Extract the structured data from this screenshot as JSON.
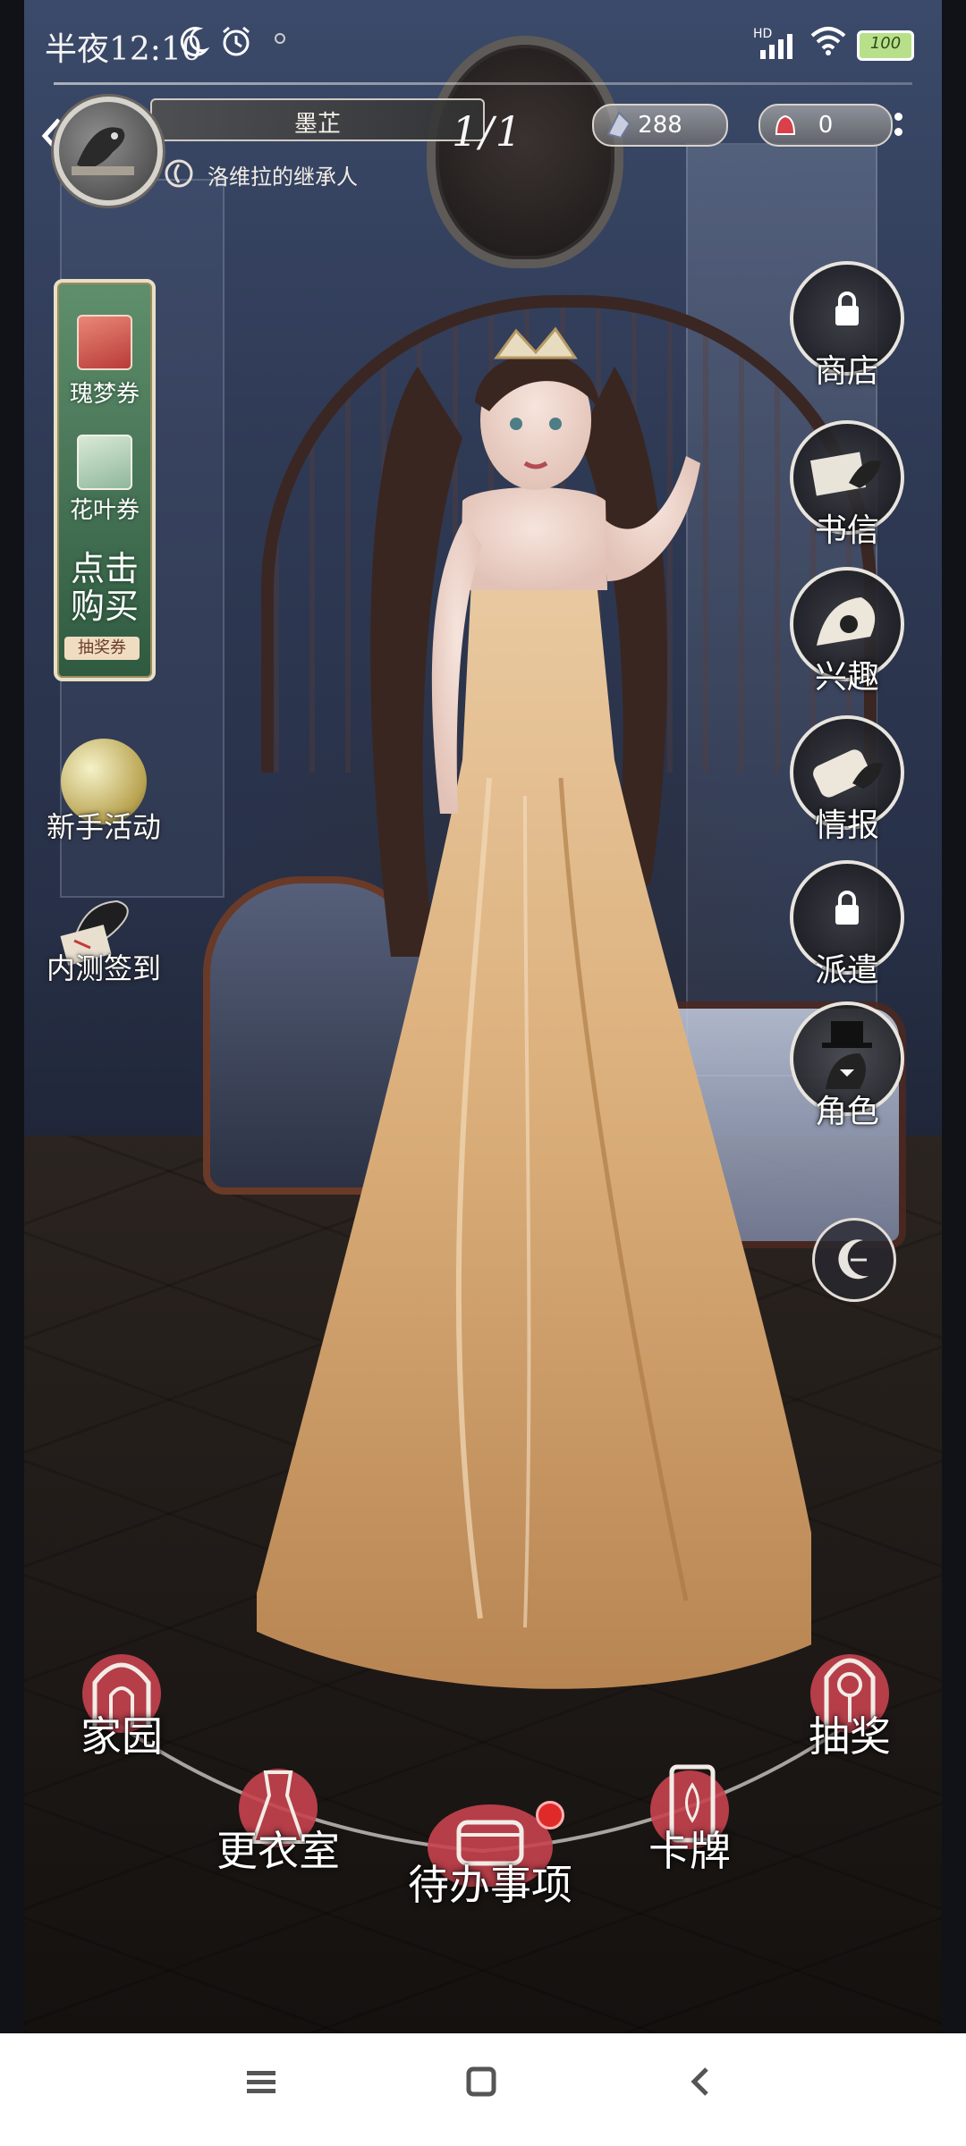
{
  "status_bar": {
    "time": "半夜12:10",
    "battery": "100",
    "network": "HD"
  },
  "profile": {
    "name": "墨芷",
    "title": "洛维拉的继承人",
    "page_indicator": "1/1"
  },
  "currencies": [
    {
      "icon": "crystal-icon",
      "value": "288"
    },
    {
      "icon": "bell-ticket-icon",
      "value": "0"
    }
  ],
  "left_panel": {
    "tickets": [
      {
        "label": "瑰梦券",
        "icon": "rose-dream-ticket-icon",
        "color": "#d75a4e"
      },
      {
        "label": "花叶券",
        "icon": "leaf-ticket-icon",
        "color": "#8fb79b"
      }
    ],
    "buy_line1": "点击",
    "buy_line2": "购买",
    "buy_sub": "抽奖券"
  },
  "left_activities": [
    {
      "label": "新手活动",
      "icon": "golden-orb-icon"
    },
    {
      "label": "内测签到",
      "icon": "raven-letter-icon"
    }
  ],
  "right_menu": [
    {
      "label": "商店",
      "icon": "shop-icon",
      "locked": true
    },
    {
      "label": "书信",
      "icon": "letter-icon",
      "locked": false
    },
    {
      "label": "兴趣",
      "icon": "interest-icon",
      "locked": false
    },
    {
      "label": "情报",
      "icon": "intel-icon",
      "locked": false
    },
    {
      "label": "派遣",
      "icon": "dispatch-icon",
      "locked": true
    },
    {
      "label": "角色",
      "icon": "character-icon",
      "locked": false
    }
  ],
  "bottom_nav": [
    {
      "label": "家园",
      "icon": "home-emblem-icon"
    },
    {
      "label": "更衣室",
      "icon": "dress-emblem-icon"
    },
    {
      "label": "待办事项",
      "icon": "todo-emblem-icon",
      "notify": true
    },
    {
      "label": "卡牌",
      "icon": "card-emblem-icon"
    },
    {
      "label": "抽奖",
      "icon": "rose-emblem-icon"
    }
  ],
  "colors": {
    "accent_red": "#c6434f",
    "ticket_green": "#4a7b58",
    "system_nav_icon": "#555555"
  }
}
